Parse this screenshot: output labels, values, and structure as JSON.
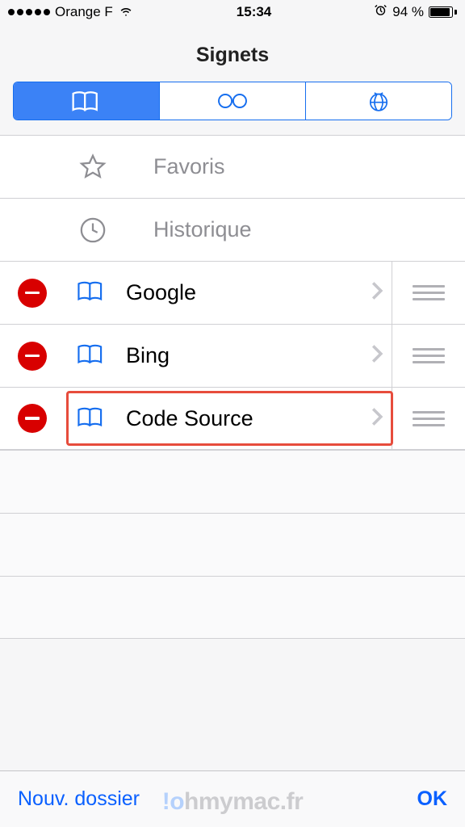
{
  "status_bar": {
    "carrier": "Orange F",
    "time": "15:34",
    "battery_percent": "94 %"
  },
  "header": {
    "title": "Signets"
  },
  "segments": {
    "bookmarks": "bookmarks",
    "reading_list": "reading-list",
    "shared": "shared-links"
  },
  "static_items": {
    "favorites": "Favoris",
    "history": "Historique"
  },
  "folders": [
    {
      "label": "Google"
    },
    {
      "label": "Bing"
    },
    {
      "label": "Code Source"
    }
  ],
  "toolbar": {
    "new_folder": "Nouv. dossier",
    "done": "OK"
  },
  "watermark": "ohmymac.fr"
}
